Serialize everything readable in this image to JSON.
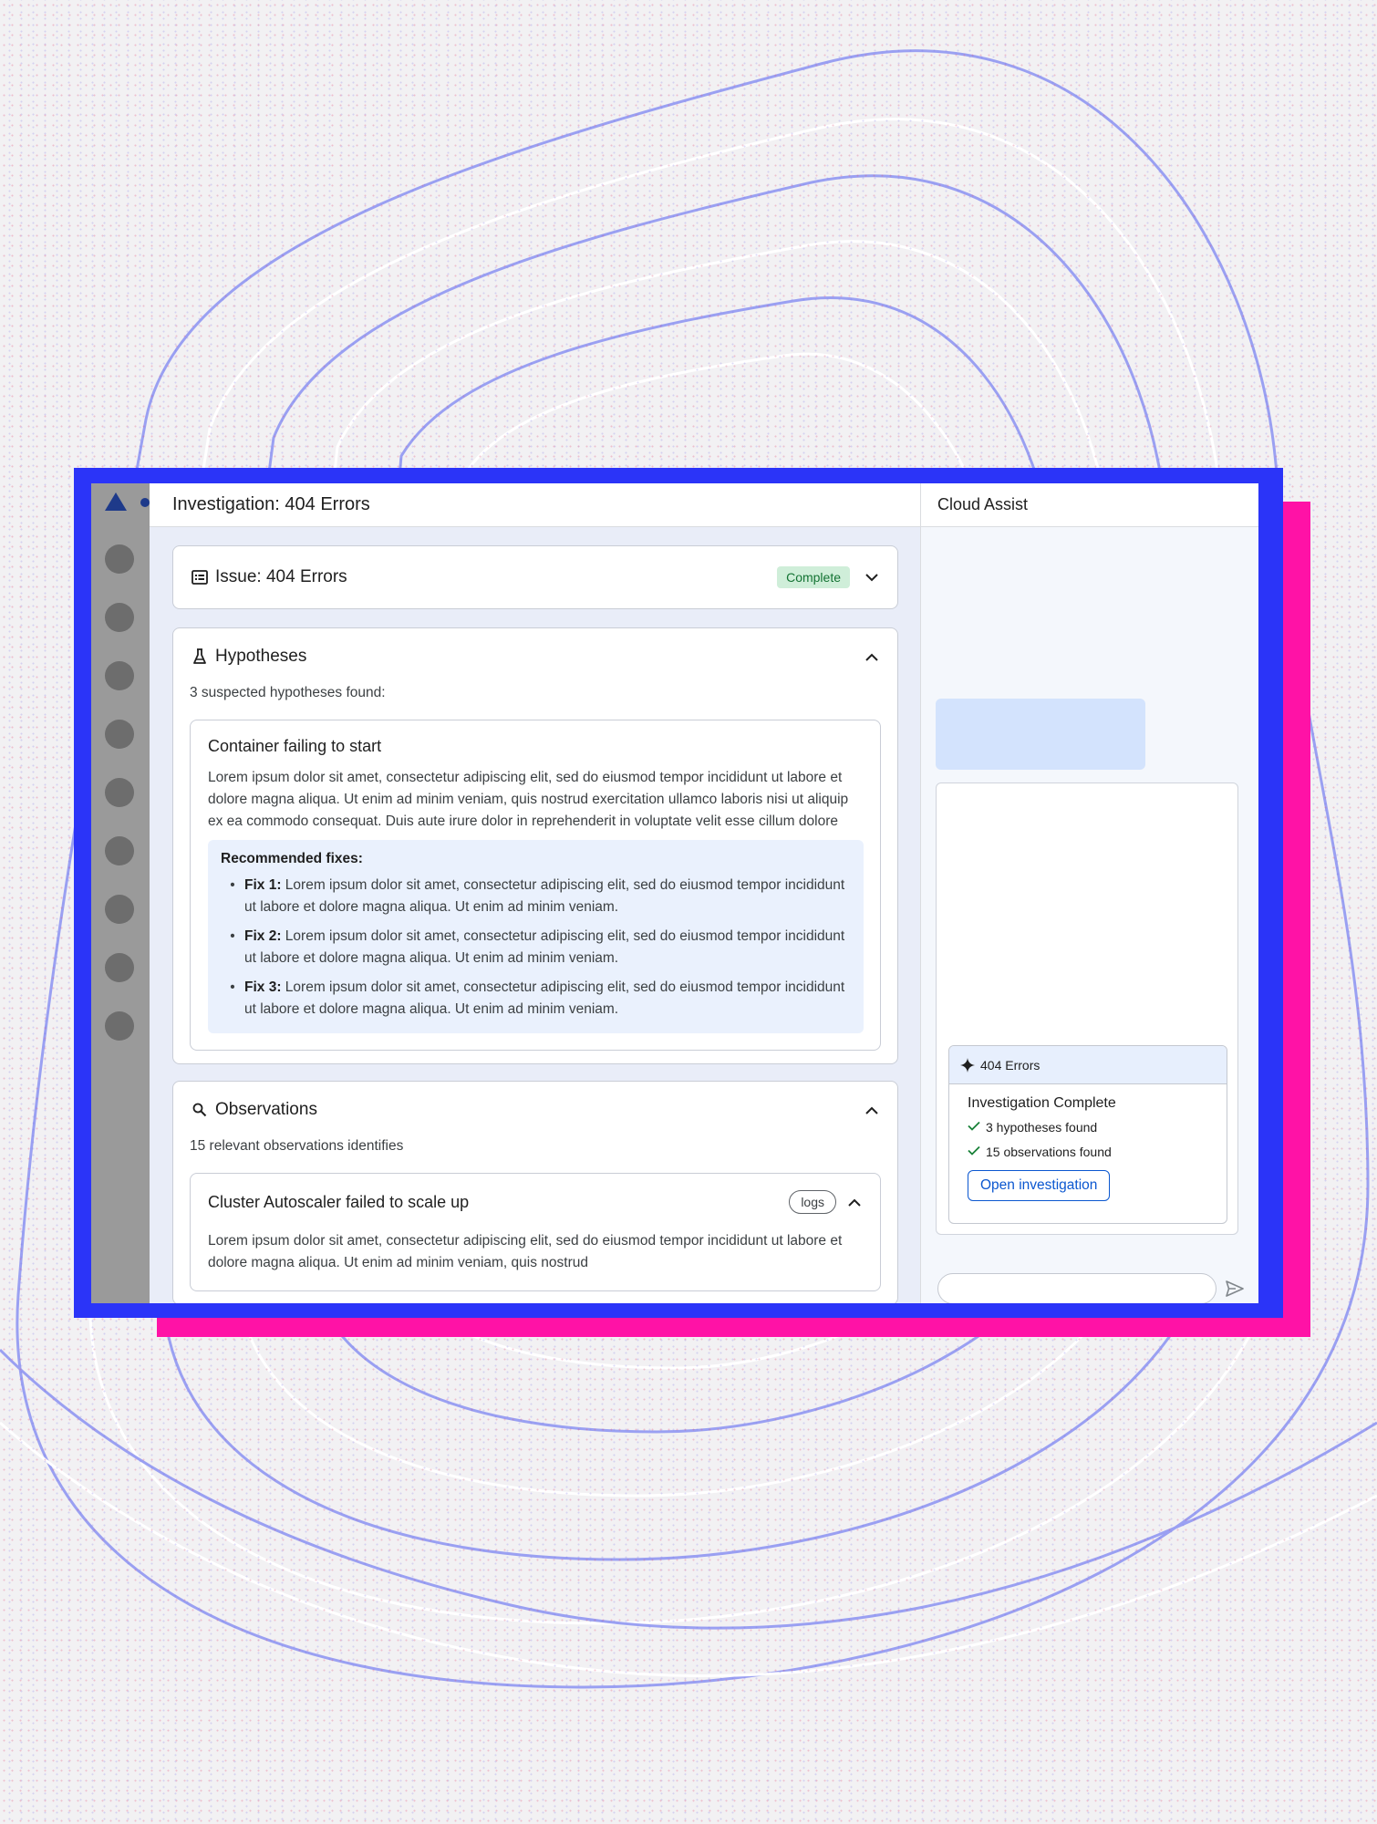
{
  "main": {
    "title": "Investigation: 404 Errors",
    "issue": {
      "label": "Issue: 404 Errors",
      "status": "Complete",
      "icon": "list-alt-icon"
    },
    "hypotheses": {
      "title": "Hypotheses",
      "icon": "flask-icon",
      "summary": "3 suspected hypotheses found:",
      "item": {
        "title": "Container failing to start",
        "body": "Lorem ipsum dolor sit amet, consectetur adipiscing elit, sed do eiusmod tempor incididunt ut labore et dolore magna aliqua. Ut enim ad minim veniam, quis nostrud exercitation ullamco laboris nisi ut aliquip ex ea commodo consequat. Duis aute irure dolor in reprehenderit in voluptate velit esse cillum dolore",
        "fixes_title": "Recommended fixes:",
        "fixes": [
          {
            "label": "Fix 1:",
            "text": "Lorem ipsum dolor sit amet, consectetur adipiscing elit, sed do eiusmod tempor incididunt ut labore et dolore magna aliqua. Ut enim ad minim veniam."
          },
          {
            "label": "Fix 2:",
            "text": "Lorem ipsum dolor sit amet, consectetur adipiscing elit, sed do eiusmod tempor incididunt ut labore et dolore magna aliqua. Ut enim ad minim veniam."
          },
          {
            "label": "Fix 3:",
            "text": "Lorem ipsum dolor sit amet, consectetur adipiscing elit, sed do eiusmod tempor incididunt ut labore et dolore magna aliqua. Ut enim ad minim veniam."
          }
        ]
      }
    },
    "observations": {
      "title": "Observations",
      "icon": "search-icon",
      "summary": "15 relevant observations identifies",
      "item": {
        "title": "Cluster Autoscaler failed to scale up",
        "tag": "logs",
        "body": "Lorem ipsum dolor sit amet, consectetur adipiscing elit, sed do eiusmod tempor incididunt ut labore et dolore magna aliqua. Ut enim ad minim veniam, quis nostrud"
      }
    }
  },
  "assist": {
    "title": "Cloud Assist",
    "result": {
      "header": "404 Errors",
      "header_icon": "sparkle-icon",
      "title": "Investigation Complete",
      "lines": [
        "3 hypotheses found",
        "15 observations found"
      ],
      "button": "Open investigation"
    },
    "input_placeholder": "",
    "send_icon": "send-icon"
  },
  "colors": {
    "accent": "#0b57d0",
    "complete_badge_bg": "#cfeed9",
    "complete_badge_text": "#137333",
    "frame_blue": "#2b34f8",
    "frame_pink": "#ff12a6"
  }
}
